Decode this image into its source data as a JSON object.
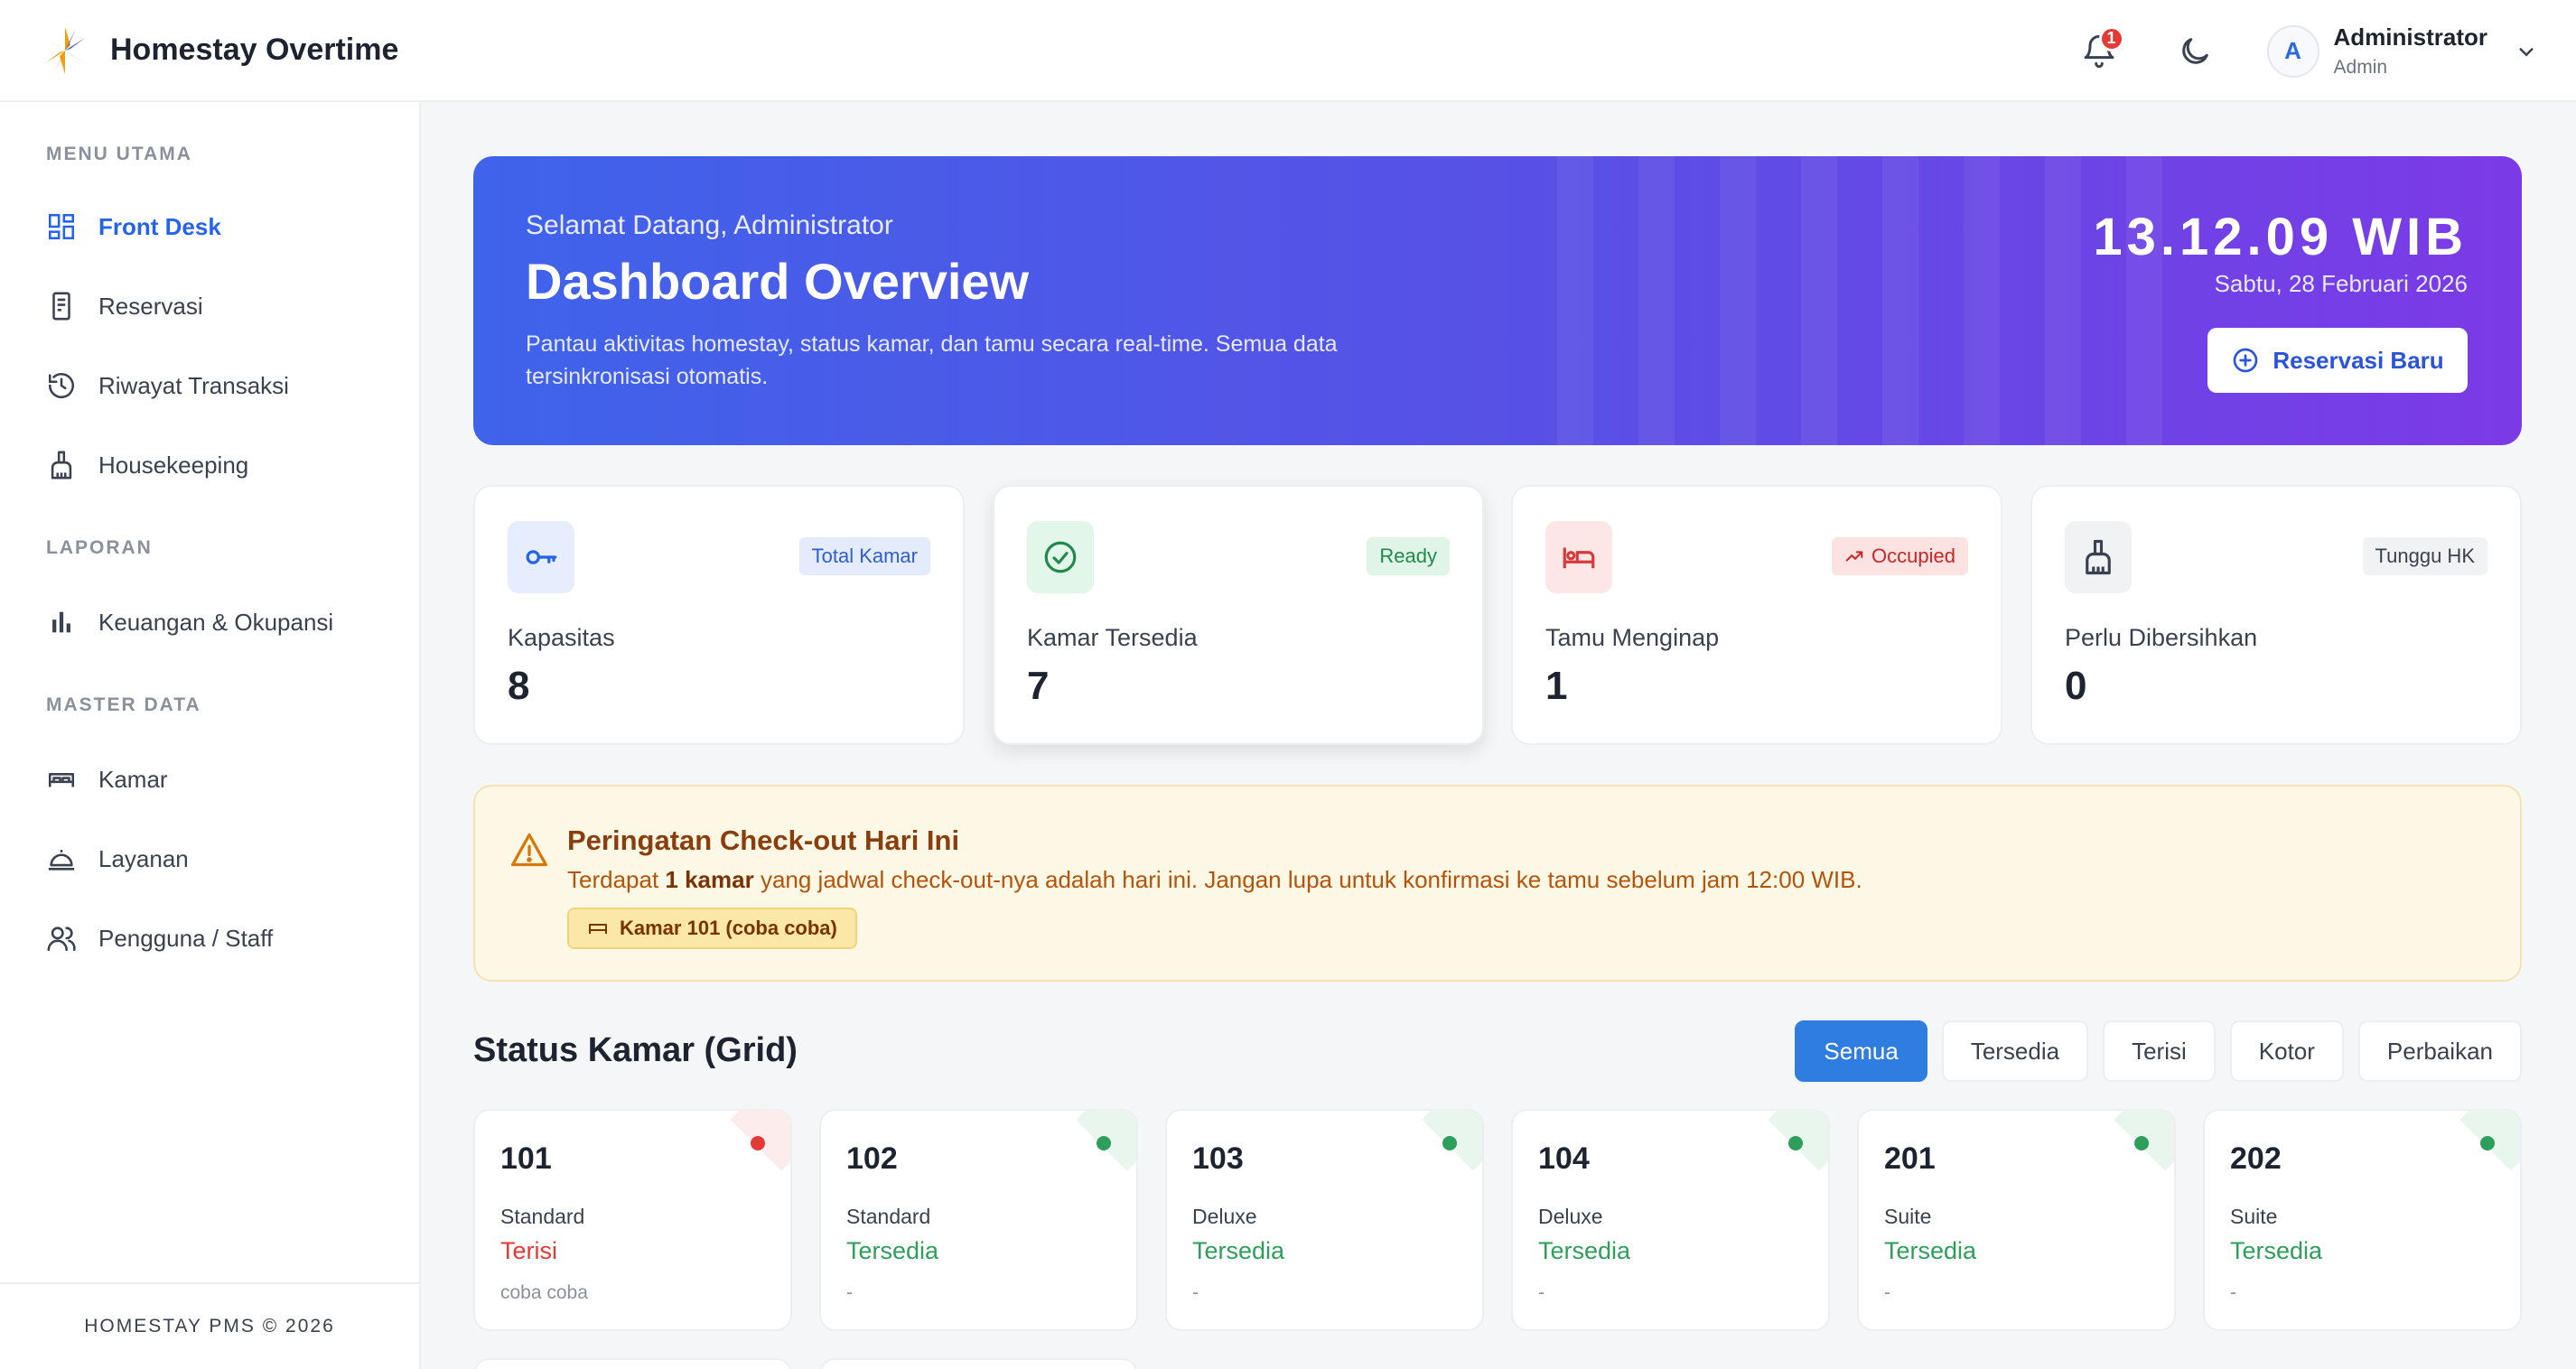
{
  "app": {
    "title": "Homestay Overtime"
  },
  "header": {
    "notification_count": "1",
    "user_initial": "A",
    "user_name": "Administrator",
    "user_role": "Admin"
  },
  "sidebar": {
    "sections": [
      "MENU UTAMA",
      "LAPORAN",
      "MASTER DATA"
    ],
    "items": [
      {
        "label": "Front Desk",
        "icon": "dashboard-icon",
        "active": true
      },
      {
        "label": "Reservasi",
        "icon": "booking-icon"
      },
      {
        "label": "Riwayat Transaksi",
        "icon": "history-icon"
      },
      {
        "label": "Housekeeping",
        "icon": "broom-icon"
      },
      {
        "label": "Keuangan & Okupansi",
        "icon": "bar-chart-icon"
      },
      {
        "label": "Kamar",
        "icon": "bed-icon"
      },
      {
        "label": "Layanan",
        "icon": "service-bell-icon"
      },
      {
        "label": "Pengguna / Staff",
        "icon": "users-icon"
      }
    ],
    "footer": "HOMESTAY PMS © 2026"
  },
  "hero": {
    "greeting": "Selamat Datang, Administrator",
    "title": "Dashboard Overview",
    "description": "Pantau aktivitas homestay, status kamar, dan tamu secara real-time. Semua data tersinkronisasi otomatis.",
    "clock": "13.12.09 WIB",
    "date": "Sabtu, 28 Februari 2026",
    "button_label": "Reservasi Baru"
  },
  "stats": [
    {
      "badge": "Total Kamar",
      "label": "Kapasitas",
      "value": "8",
      "icon": "key-icon"
    },
    {
      "badge": "Ready",
      "label": "Kamar Tersedia",
      "value": "7",
      "icon": "check-circle-icon"
    },
    {
      "badge": "Occupied",
      "label": "Tamu Menginap",
      "value": "1",
      "icon": "bed-icon"
    },
    {
      "badge": "Tunggu HK",
      "label": "Perlu Dibersihkan",
      "value": "0",
      "icon": "broom-icon"
    }
  ],
  "warning": {
    "title": "Peringatan Check-out Hari Ini",
    "desc_prefix": "Terdapat ",
    "desc_bold": "1 kamar",
    "desc_suffix": " yang jadwal check-out-nya adalah hari ini. Jangan lupa untuk konfirmasi ke tamu sebelum jam 12:00 WIB.",
    "chip": "Kamar 101 (coba coba)"
  },
  "status_grid": {
    "title": "Status Kamar (Grid)",
    "filters": [
      "Semua",
      "Tersedia",
      "Terisi",
      "Kotor",
      "Perbaikan"
    ],
    "active_filter": "Semua",
    "rooms": [
      {
        "number": "101",
        "type": "Standard",
        "status": "Terisi",
        "guest": "coba coba",
        "color": "#e53935"
      },
      {
        "number": "102",
        "type": "Standard",
        "status": "Tersedia",
        "guest": "-",
        "color": "#2e9e5b"
      },
      {
        "number": "103",
        "type": "Deluxe",
        "status": "Tersedia",
        "guest": "-",
        "color": "#2e9e5b"
      },
      {
        "number": "104",
        "type": "Deluxe",
        "status": "Tersedia",
        "guest": "-",
        "color": "#2e9e5b"
      },
      {
        "number": "201",
        "type": "Suite",
        "status": "Tersedia",
        "guest": "-",
        "color": "#2e9e5b"
      },
      {
        "number": "202",
        "type": "Suite",
        "status": "Tersedia",
        "guest": "-",
        "color": "#2e9e5b"
      }
    ]
  },
  "colors": {
    "accent": "#2563eb",
    "occupied": "#e53935",
    "available": "#2e9e5b",
    "warning": "#b45309"
  }
}
